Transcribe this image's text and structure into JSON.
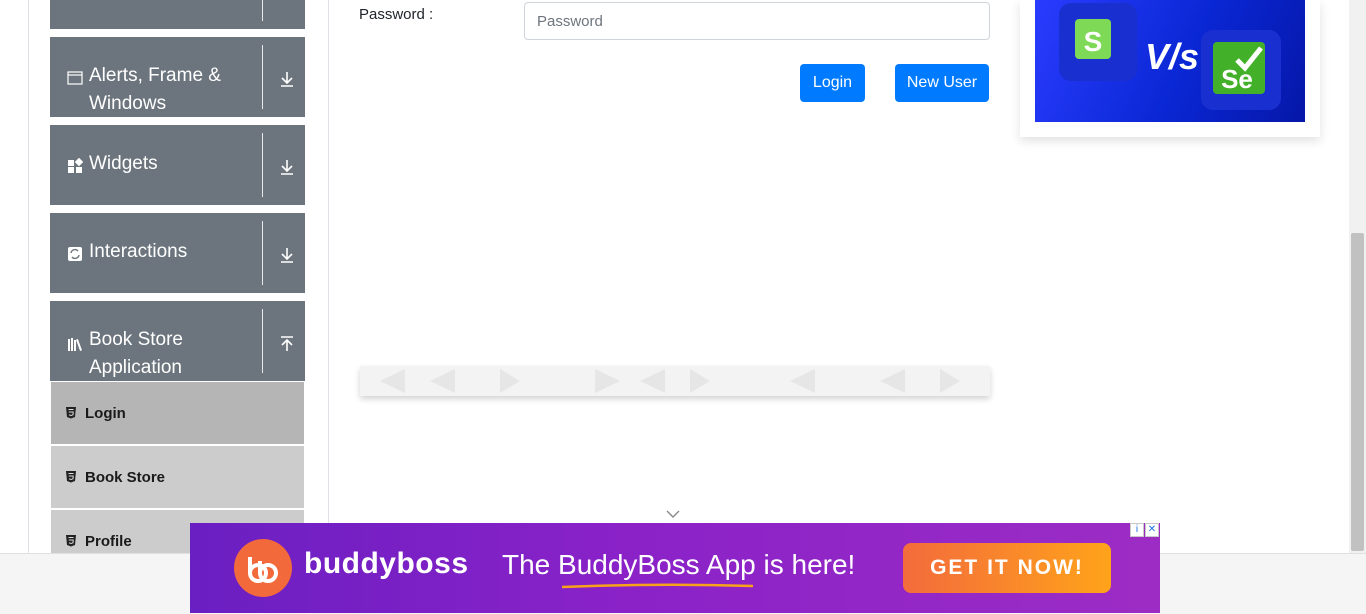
{
  "sidebar": {
    "groups": [
      {
        "label": "",
        "icon": "collapsed-group"
      },
      {
        "label": "Alerts, Frame & Windows",
        "icon": "window-icon",
        "arrow": "download-arrow-icon"
      },
      {
        "label": "Widgets",
        "icon": "widgets-icon",
        "arrow": "download-arrow-icon"
      },
      {
        "label": "Interactions",
        "icon": "interactions-icon",
        "arrow": "download-arrow-icon"
      },
      {
        "label": "Book Store Application",
        "icon": "book-store-icon",
        "arrow": "upload-arrow-icon"
      }
    ],
    "items": [
      {
        "label": "Login",
        "active": true
      },
      {
        "label": "Book Store",
        "active": false
      },
      {
        "label": "Profile",
        "active": false
      }
    ]
  },
  "form": {
    "password_label": "Password :",
    "password_placeholder": "Password",
    "login_label": "Login",
    "new_user_label": "New User"
  },
  "ads": {
    "top_right_vs": "V/s",
    "top_right_left_logo": "S",
    "top_right_right_logo": "Se",
    "bottom_brand": "buddyboss",
    "bottom_tagline": "The BuddyBoss App is here!",
    "bottom_cta": "GET IT NOW!"
  },
  "colors": {
    "sidebar_group_bg": "#6c757d",
    "active_item_bg": "#b8b8b8",
    "item_bg": "#cccccc",
    "primary_button": "#007bff"
  }
}
